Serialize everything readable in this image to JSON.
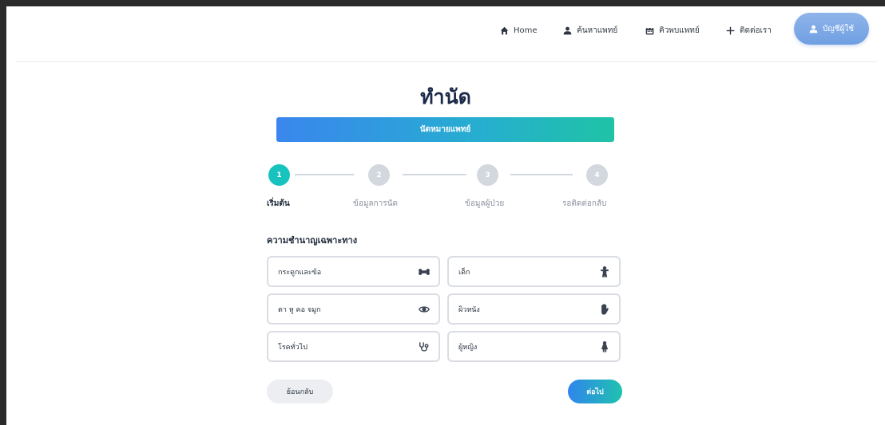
{
  "nav": {
    "home": "Home",
    "find_doctor": "ค้นหาแพทย์",
    "doctor_queue": "คิวพบแพทย์",
    "contact": "ติดต่อเรา",
    "account": "บัญชีผู้ใช้"
  },
  "page": {
    "title": "ทำนัด",
    "banner": "นัดหมายแพทย์"
  },
  "stepper": {
    "steps": [
      {
        "number": "1",
        "label": "เริ่มต้น"
      },
      {
        "number": "2",
        "label": "ข้อมูลการนัด"
      },
      {
        "number": "3",
        "label": "ข้อมูลผู้ป่วย"
      },
      {
        "number": "4",
        "label": "รอติดต่อกลับ"
      }
    ]
  },
  "specialty": {
    "label": "ความชำนาญเฉพาะทาง",
    "options": [
      {
        "label": "กระดูกและข้อ",
        "icon": "bone-icon"
      },
      {
        "label": "เด็ก",
        "icon": "child-icon"
      },
      {
        "label": "ตา หู คอ จมูก",
        "icon": "eye-icon"
      },
      {
        "label": "ผิวหนัง",
        "icon": "hand-icon"
      },
      {
        "label": "โรคทั่วไป",
        "icon": "stethoscope-icon"
      },
      {
        "label": "ผู้หญิง",
        "icon": "female-icon"
      }
    ]
  },
  "actions": {
    "back": "ย้อนกลับ",
    "next": "ต่อไป"
  },
  "colors": {
    "accent_teal": "#17c2bf",
    "accent_blue": "#3a86ee",
    "inactive_step": "#d3d7de"
  }
}
